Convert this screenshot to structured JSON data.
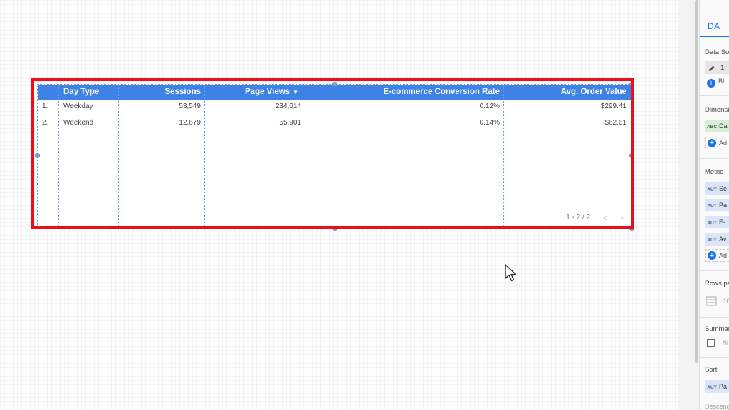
{
  "table": {
    "columns": [
      {
        "label": "Day Type",
        "align": "left"
      },
      {
        "label": "Sessions",
        "align": "right"
      },
      {
        "label": "Page Views",
        "align": "right",
        "sorted": true,
        "sort_icon": "sort-desc-icon"
      },
      {
        "label": "E-commerce Conversion Rate",
        "align": "right"
      },
      {
        "label": "Avg. Order Value",
        "align": "right"
      }
    ],
    "rows": [
      {
        "index": "1.",
        "cells": [
          "Weekday",
          "53,549",
          "234,614",
          "0.12%",
          "$299.41"
        ]
      },
      {
        "index": "2.",
        "cells": [
          "Weekend",
          "12,679",
          "55,901",
          "0.14%",
          "$62.61"
        ]
      }
    ],
    "pagination": {
      "text": "1 - 2 / 2",
      "prev_icon": "chevron-left-icon",
      "next_icon": "chevron-right-icon"
    }
  },
  "panel": {
    "tab_label": "DA",
    "data_source": {
      "title": "Data Sou",
      "edit_icon": "pencil-icon",
      "value": "1",
      "add_label": "BL"
    },
    "dimension": {
      "title": "Dimensi",
      "chips": [
        {
          "tag": "ABC",
          "label": "Da"
        }
      ],
      "add_label": "Ad"
    },
    "metric": {
      "title": "Metric",
      "chips": [
        {
          "tag": "AUT",
          "label": "Se"
        },
        {
          "tag": "AUT",
          "label": "Pa"
        },
        {
          "tag": "AUT",
          "label": "E-"
        },
        {
          "tag": "AUT",
          "label": "Av"
        }
      ],
      "add_label": "Ad"
    },
    "rows_per_page": {
      "title": "Rows pe",
      "value": "10"
    },
    "summary": {
      "title": "Summar",
      "checkbox_label": "Sh"
    },
    "sort": {
      "title": "Sort",
      "chip": {
        "tag": "AUT",
        "label": "Pa"
      },
      "order_label": "Descend"
    }
  },
  "colors": {
    "header_bg": "#3f82e6",
    "highlight": "#e8111b",
    "accent": "#1a73e8"
  }
}
